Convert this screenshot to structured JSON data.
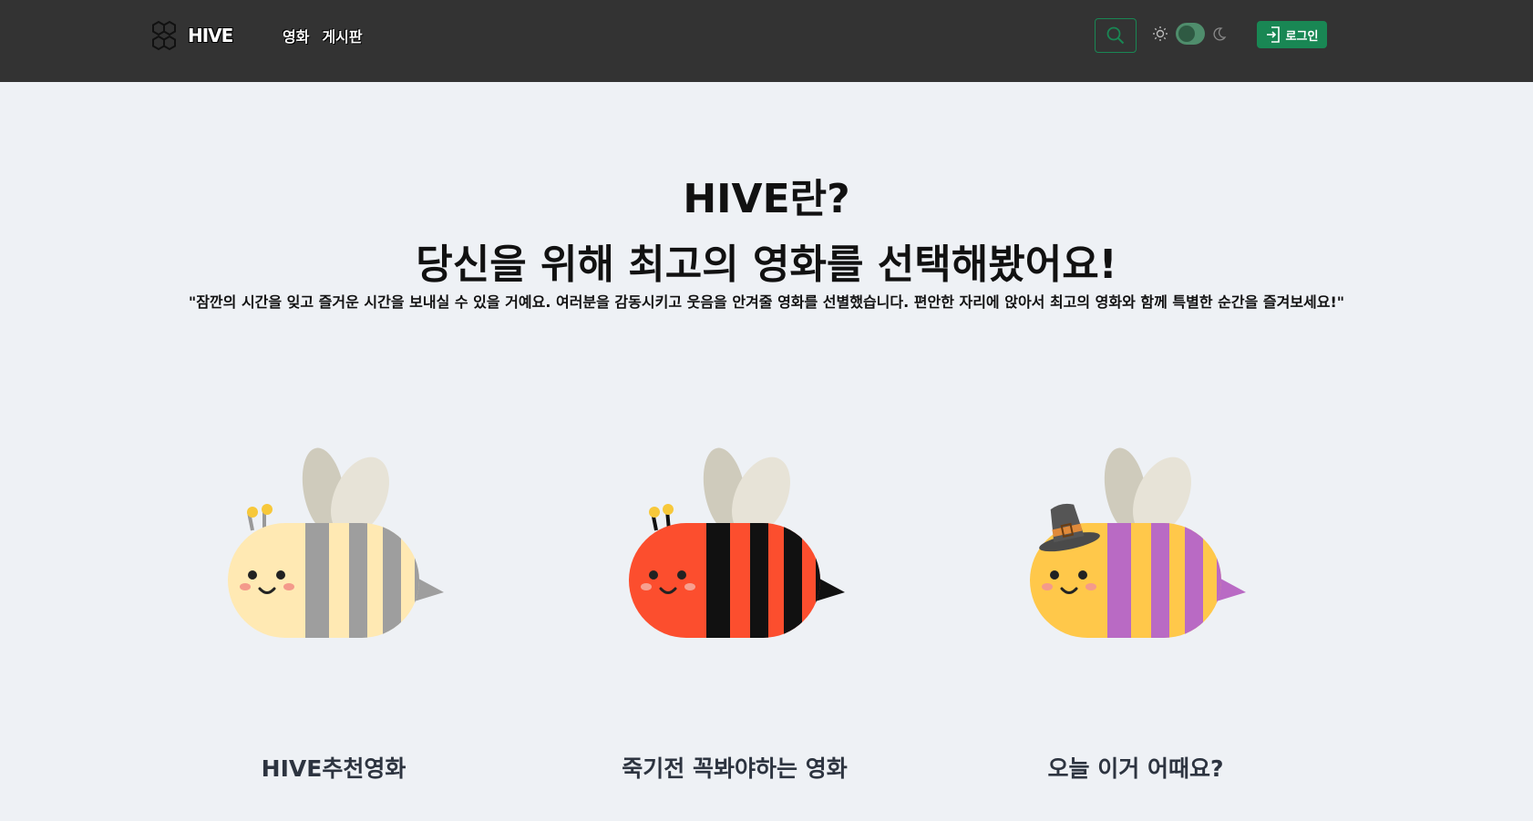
{
  "nav": {
    "brand": "HIVE",
    "links": [
      "영화",
      "게시판"
    ],
    "login_label": "로그인"
  },
  "hero": {
    "title": "HIVE란?",
    "subtitle": "당신을 위해 최고의 영화를 선택해봤어요!",
    "quote": "\"잠깐의 시간을 잊고 즐거운 시간을 보내실 수 있을 거예요. 여러분을 감동시키고 웃음을 안겨줄 영화를 선별했습니다. 편안한 자리에 앉아서 최고의 영화와 함께 특별한 순간을 즐겨보세요!\""
  },
  "cards": [
    {
      "label": "HIVE추천영화",
      "icon": "bee-cream-icon",
      "body_color": "#ffe9b3",
      "stripe_color": "#9e9e9e"
    },
    {
      "label": "죽기전 꼭봐야하는 영화",
      "icon": "bee-red-icon",
      "body_color": "#fc4e2e",
      "stripe_color": "#111111"
    },
    {
      "label": "오늘 이거 어때요?",
      "icon": "bee-pilgrim-icon",
      "body_color": "#ffc84a",
      "stripe_color": "#b96ac4"
    }
  ],
  "colors": {
    "navbar": "#333333",
    "accent": "#198754",
    "background": "#eef1f5"
  }
}
